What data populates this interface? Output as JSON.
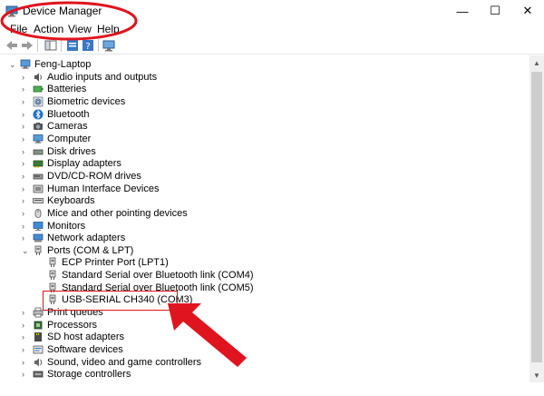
{
  "window": {
    "title": "Device Manager",
    "icon": "device-manager-icon",
    "controls": {
      "minimize": "—",
      "maximize": "☐",
      "close": "✕"
    }
  },
  "menu": [
    "File",
    "Action",
    "View",
    "Help"
  ],
  "toolbar": {
    "buttons": [
      "back-icon",
      "forward-icon",
      "show-hide-tree-icon",
      "properties-icon",
      "help-icon",
      "scan-hardware-icon"
    ]
  },
  "tree": {
    "root": "Feng-Laptop",
    "items": [
      {
        "label": "Audio inputs and outputs",
        "icon": "speaker-icon"
      },
      {
        "label": "Batteries",
        "icon": "battery-icon"
      },
      {
        "label": "Biometric devices",
        "icon": "fingerprint-icon"
      },
      {
        "label": "Bluetooth",
        "icon": "bluetooth-icon"
      },
      {
        "label": "Cameras",
        "icon": "camera-icon"
      },
      {
        "label": "Computer",
        "icon": "computer-icon"
      },
      {
        "label": "Disk drives",
        "icon": "disk-drive-icon"
      },
      {
        "label": "Display adapters",
        "icon": "display-adapter-icon"
      },
      {
        "label": "DVD/CD-ROM drives",
        "icon": "optical-drive-icon"
      },
      {
        "label": "Human Interface Devices",
        "icon": "hid-icon"
      },
      {
        "label": "Keyboards",
        "icon": "keyboard-icon"
      },
      {
        "label": "Mice and other pointing devices",
        "icon": "mouse-icon"
      },
      {
        "label": "Monitors",
        "icon": "monitor-icon"
      },
      {
        "label": "Network adapters",
        "icon": "network-adapter-icon"
      },
      {
        "label": "Ports (COM & LPT)",
        "icon": "port-icon",
        "expanded": true
      },
      {
        "label": "ECP Printer Port (LPT1)",
        "icon": "port-icon",
        "child": true
      },
      {
        "label": "Standard Serial over Bluetooth link (COM4)",
        "icon": "port-icon",
        "child": true
      },
      {
        "label": "Standard Serial over Bluetooth link (COM5)",
        "icon": "port-icon",
        "child": true
      },
      {
        "label": "USB-SERIAL CH340 (COM3)",
        "icon": "port-icon",
        "child": true,
        "highlighted": true
      },
      {
        "label": "Print queues",
        "icon": "printer-icon"
      },
      {
        "label": "Processors",
        "icon": "processor-icon"
      },
      {
        "label": "SD host adapters",
        "icon": "sd-card-icon"
      },
      {
        "label": "Software devices",
        "icon": "software-device-icon"
      },
      {
        "label": "Sound, video and game controllers",
        "icon": "sound-icon"
      },
      {
        "label": "Storage controllers",
        "icon": "storage-controller-icon"
      }
    ]
  },
  "colors": {
    "annotation": "#e0141e",
    "toolbar_accent": "#3a78c2"
  }
}
